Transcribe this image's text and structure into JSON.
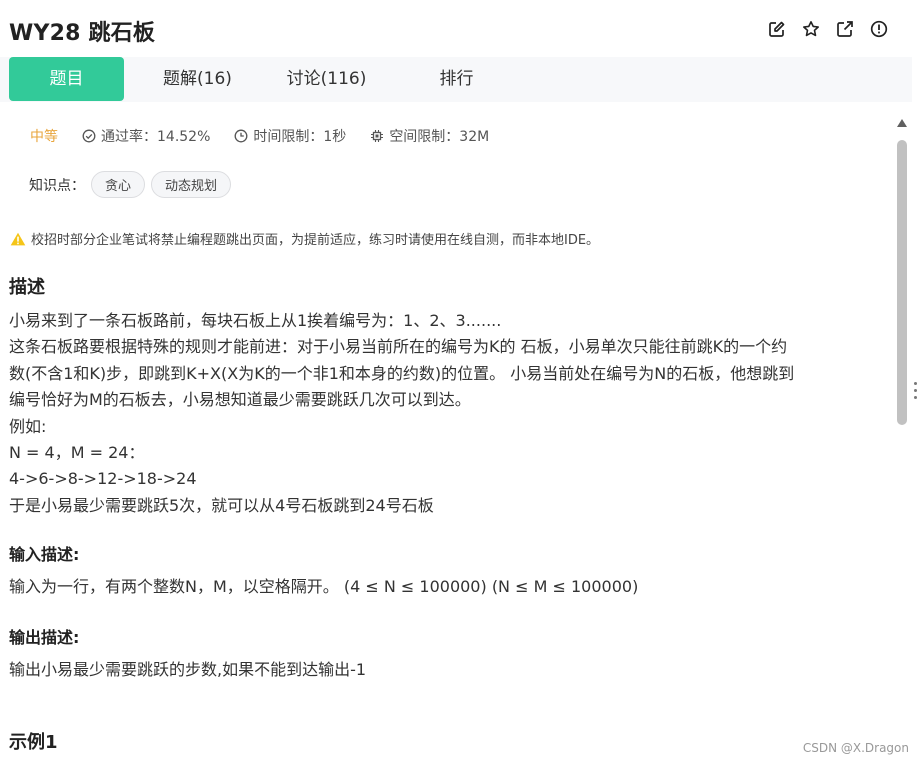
{
  "header": {
    "title": "WY28  跳石板"
  },
  "tabs": [
    {
      "label": "题目"
    },
    {
      "label": "题解(16)"
    },
    {
      "label": "讨论(116)"
    },
    {
      "label": "排行"
    }
  ],
  "meta": {
    "difficulty": "中等",
    "pass_rate": "通过率：14.52%",
    "time_limit": "时间限制：1秒",
    "space_limit": "空间限制：32M"
  },
  "knowledge": {
    "label": "知识点：",
    "tags": [
      "贪心",
      "动态规划"
    ]
  },
  "notice": "校招时部分企业笔试将禁止编程题跳出页面，为提前适应，练习时请使用在线自测，而非本地IDE。",
  "description": {
    "title": "描述",
    "lines": [
      "小易来到了一条石板路前，每块石板上从1挨着编号为：1、2、3.......",
      "这条石板路要根据特殊的规则才能前进：对于小易当前所在的编号为K的 石板，小易单次只能往前跳K的一个约",
      "数(不含1和K)步，即跳到K+X(X为K的一个非1和本身的约数)的位置。 小易当前处在编号为N的石板，他想跳到",
      "编号恰好为M的石板去，小易想知道最少需要跳跃几次可以到达。",
      "例如:",
      "N = 4，M = 24：",
      "4->6->8->12->18->24",
      "于是小易最少需要跳跃5次，就可以从4号石板跳到24号石板"
    ]
  },
  "input": {
    "title": "输入描述:",
    "text": "输入为一行，有两个整数N，M，以空格隔开。 (4 ≤ N ≤ 100000) (N ≤ M ≤ 100000)"
  },
  "output": {
    "title": "输出描述:",
    "text": "输出小易最少需要跳跃的步数,如果不能到达输出-1"
  },
  "example": {
    "title": "示例1"
  },
  "watermark": "CSDN @X.Dragon",
  "colors": {
    "accent": "#32ca99",
    "difficulty": "#e8a53c",
    "warning": "#f5c518"
  }
}
